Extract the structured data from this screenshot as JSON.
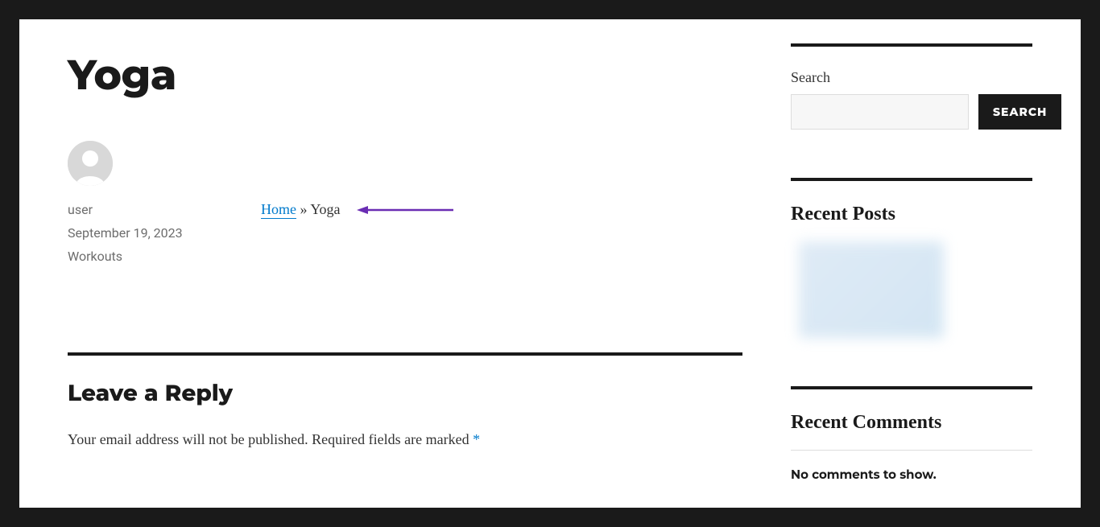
{
  "post": {
    "title": "Yoga",
    "author": "user",
    "date": "September 19, 2023",
    "category": "Workouts"
  },
  "breadcrumb": {
    "home_label": "Home",
    "separator": " » ",
    "current": "Yoga"
  },
  "reply": {
    "heading": "Leave a Reply",
    "note_prefix": "Your email address will not be published.",
    "note_required": "Required fields are marked ",
    "asterisk": "*"
  },
  "sidebar": {
    "search": {
      "label": "Search",
      "button": "SEARCH"
    },
    "recent_posts": {
      "title": "Recent Posts"
    },
    "recent_comments": {
      "title": "Recent Comments",
      "empty": "No comments to show."
    }
  }
}
